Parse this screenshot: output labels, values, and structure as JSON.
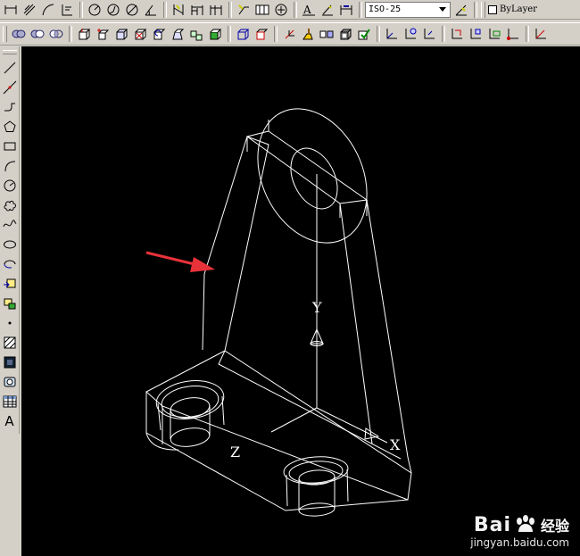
{
  "toolbar_top": {
    "dimstyle_value": "ISO-25",
    "layer_value": "ByLayer"
  },
  "left_toolbar": {
    "text_tool_label": "A"
  },
  "canvas": {
    "axis_y_label": "Y",
    "axis_x_label": "X",
    "axis_z_label": "Z"
  },
  "watermark": {
    "brand": "Bai",
    "brand2": "经验",
    "url": "jingyan.baidu.com"
  },
  "colors": {
    "canvas_bg": "#000000",
    "wire": "#ffffff",
    "arrow": "#e8323a",
    "toolbar_bg": "#d4d0c8"
  }
}
